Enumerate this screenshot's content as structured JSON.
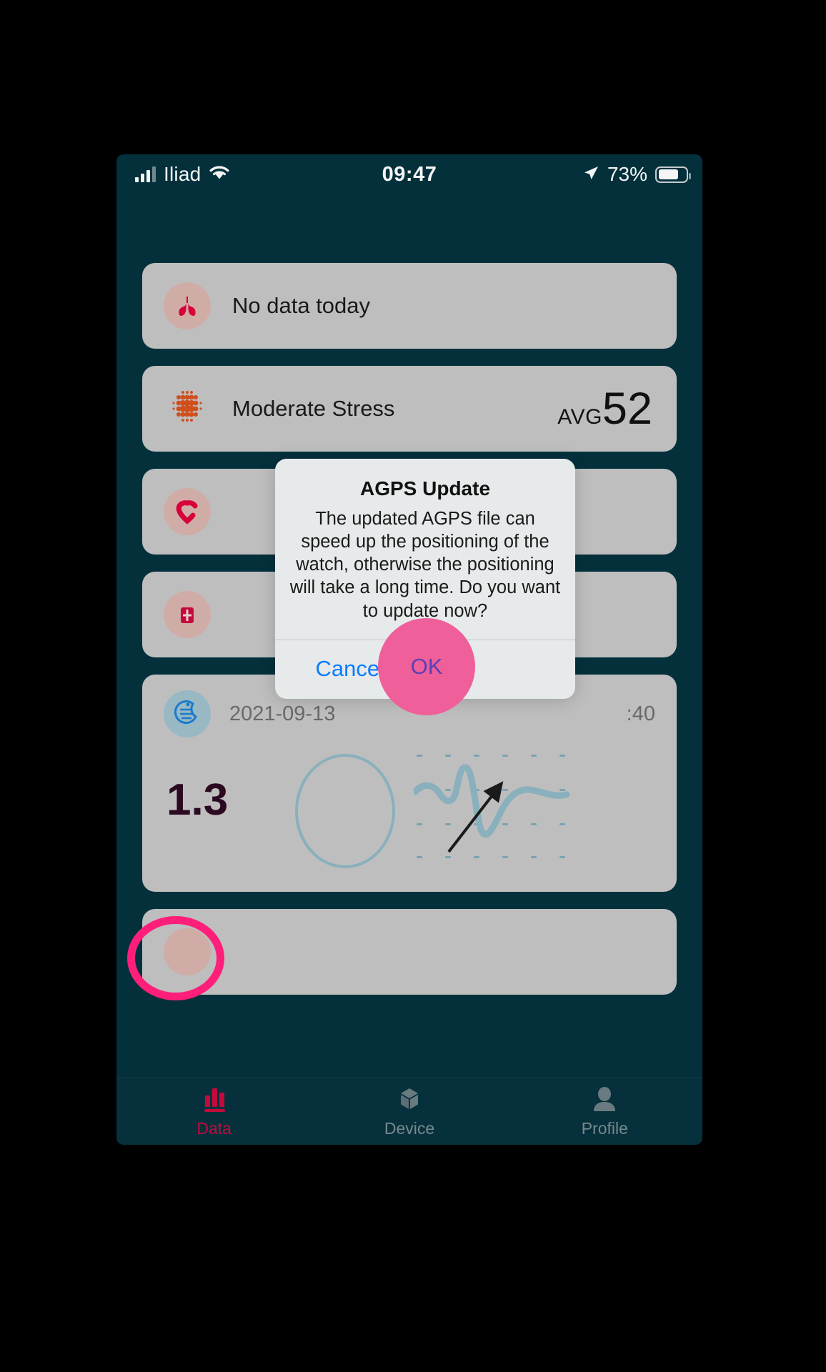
{
  "statusbar": {
    "carrier": "Iliad",
    "time": "09:47",
    "battery_percent": "73%",
    "signal_icon": "cellular-bars-icon",
    "wifi_icon": "wifi-icon",
    "location_icon": "location-arrow-icon",
    "battery_icon": "battery-icon"
  },
  "cards": [
    {
      "id": "spo2-card",
      "icon": "lungs-icon",
      "label": "No data today",
      "icon_color": "#e0003c",
      "icon_bg": "#d9b3ad"
    },
    {
      "id": "stress-card",
      "icon": "stress-dots-icon",
      "label": "Moderate Stress",
      "avg_label": "AVG",
      "avg_value": "52",
      "icon_color": "#d9531e"
    },
    {
      "id": "heart-rate-card",
      "icon": "heart-rate-icon",
      "label": "",
      "icon_color": "#e0003c",
      "icon_bg": "#d9b3ad"
    },
    {
      "id": "blood-pressure-card",
      "icon": "blood-pressure-icon",
      "label": "",
      "icon_color": "#cc0b3f",
      "icon_bg": "#d9b3ad"
    }
  ],
  "sleep_card": {
    "id": "sleep-card",
    "icon": "moon-sleep-icon",
    "date": "2021-09-13",
    "duration": ":40",
    "value": "1.3",
    "chart_icon": "waveform-chart-icon",
    "ring_icon": "progress-ring-icon",
    "icon_color": "#1b7fd4",
    "chart_color": "#8fb8c4"
  },
  "dialog": {
    "title": "AGPS Update",
    "message": "The updated AGPS file can speed up the positioning of the watch, otherwise the positioning will take a long time. Do you want to update now?",
    "cancel_label": "Cancel",
    "ok_label": "OK",
    "cancel_color": "#0a7cff",
    "ok_color": "#5b3fb5"
  },
  "tabbar": {
    "items": [
      {
        "label": "Data",
        "icon": "bar-chart-icon",
        "active": true,
        "color": "#cc0b3f"
      },
      {
        "label": "Device",
        "icon": "device-cube-icon",
        "active": false,
        "color": "#7d8f93"
      },
      {
        "label": "Profile",
        "icon": "person-icon",
        "active": false,
        "color": "#7d8f93"
      }
    ]
  },
  "annotations": {
    "ok_highlight_color": "#ef5f9a",
    "data_highlight_color": "#ff1f7a",
    "arrow_color": "#1a1a1a"
  },
  "theme": {
    "app_background": "#05323f",
    "card_background": "#c6c6c6",
    "tabbar_background": "#07333f",
    "dialog_background": "#e6eaea",
    "page_background": "#000000"
  }
}
